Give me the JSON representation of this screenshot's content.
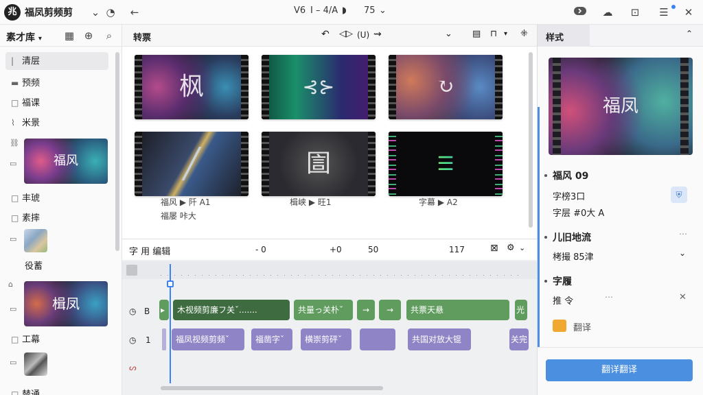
{
  "app": {
    "logo": "兆",
    "title": "福凤剪频剪"
  },
  "toolbar": {
    "version": "V6",
    "timecode": "I – 4/A",
    "zoom": "75",
    "icons": [
      "back-arrow-icon",
      "play-icon",
      "minimize-icon",
      "cloud-icon",
      "briefcase-icon",
      "notes-icon",
      "close-icon"
    ]
  },
  "left": {
    "library_label": "素才库",
    "items": [
      {
        "label": "清层"
      },
      {
        "label": "预频"
      },
      {
        "label": "福课"
      },
      {
        "label": "米景"
      },
      {
        "label": "丰琥"
      },
      {
        "label": "素摔"
      },
      {
        "label": "役蓄"
      },
      {
        "label": "工幕"
      },
      {
        "label": "替通"
      }
    ],
    "thumb_text_1": "福风",
    "thumb_text_2": "楫凤"
  },
  "center": {
    "tab_label": "转票",
    "subtoolbar_mid": "(U)",
    "cards": [
      {
        "glyph": "枫"
      },
      {
        "glyph": "⊰⊱"
      },
      {
        "glyph": "↻"
      },
      {
        "glyph": "╱"
      },
      {
        "glyph": "圁"
      },
      {
        "glyph": "☰"
      }
    ],
    "captions": [
      {
        "title": "福风 ▶ 阡 A1",
        "sub": "福屡 咔大"
      },
      {
        "title": "楫峡 ▶ 旺1",
        "sub": ""
      },
      {
        "title": "字幕 ▶ A2",
        "sub": ""
      }
    ]
  },
  "timeline": {
    "label": "字 用 编辑",
    "marks": [
      "- 0",
      "+0",
      "50",
      "117"
    ],
    "track1": {
      "label": "B"
    },
    "track2": {
      "label": "1"
    },
    "green_clips": [
      "木视频剪廉フ关ˇ.......",
      "共量っ关朴ˇ",
      "→",
      "→",
      "共票天悬",
      "光"
    ],
    "purple_clips": [
      "福凤视频剪频ˇ",
      "福凿字ˇ",
      "横崇剪砰ˇ",
      "",
      "共国对放大锟",
      "关完"
    ]
  },
  "right": {
    "tab_label": "样式",
    "preview_text": "福凤",
    "section1_title": "福风 09",
    "field1": "字榜3口",
    "field2": "字层 #0大 A",
    "section2_title": "儿旧地流",
    "field3": "栲撮 85津",
    "section3_title": "字履",
    "field4": "推 令",
    "translate_label": "翻译",
    "primary_button": "翻详翻译"
  }
}
